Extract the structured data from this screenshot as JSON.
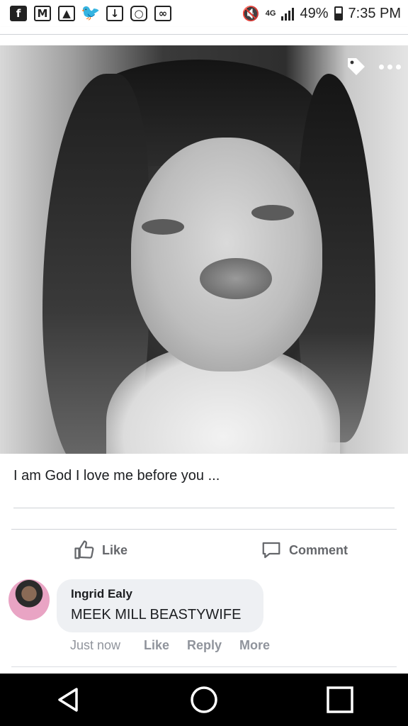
{
  "status_bar": {
    "time": "7:35 PM",
    "battery": "49%",
    "network": "4G",
    "notification_icons": [
      "facebook-icon",
      "gmail-icon",
      "gallery-icon",
      "twitter-icon",
      "download-icon",
      "instagram-icon",
      "voicemail-icon"
    ]
  },
  "post": {
    "caption": "I am God I love me before you ..."
  },
  "actions": {
    "like_label": "Like",
    "comment_label": "Comment"
  },
  "comment": {
    "author": "Ingrid Ealy",
    "text": "MEEK MILL BEASTYWIFE",
    "time": "Just now",
    "like": "Like",
    "reply": "Reply",
    "more": "More"
  },
  "colors": {
    "meta_gray": "#90949c",
    "action_gray": "#65676b",
    "bubble": "#eef0f3"
  }
}
